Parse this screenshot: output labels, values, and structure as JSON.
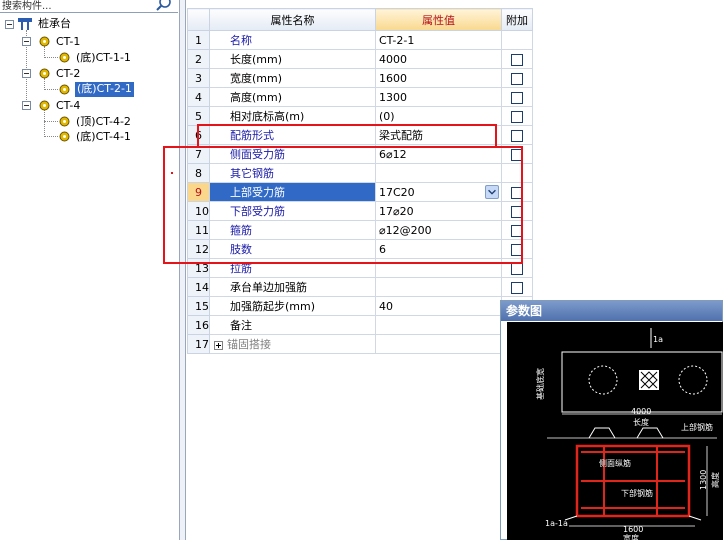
{
  "search": {
    "text": "搜索构件..."
  },
  "tree": {
    "root": "桩承台",
    "groups": [
      {
        "label": "CT-1",
        "children": [
          "(底)CT-1-1"
        ]
      },
      {
        "label": "CT-2",
        "children": [
          "(底)CT-2-1"
        ]
      },
      {
        "label": "CT-4",
        "children": [
          "(顶)CT-4-2",
          "(底)CT-4-1"
        ]
      }
    ],
    "selected": "(底)CT-2-1"
  },
  "grid": {
    "headers": {
      "name": "属性名称",
      "value": "属性值",
      "extra": "附加"
    },
    "rows": [
      {
        "no": "1",
        "name": "名称",
        "value": "CT-2-1"
      },
      {
        "no": "2",
        "name": "长度(mm)",
        "value": "4000"
      },
      {
        "no": "3",
        "name": "宽度(mm)",
        "value": "1600"
      },
      {
        "no": "4",
        "name": "高度(mm)",
        "value": "1300"
      },
      {
        "no": "5",
        "name": "相对底标高(m)",
        "value": "(0)"
      },
      {
        "no": "6",
        "name": "配筋形式",
        "value": "梁式配筋"
      },
      {
        "no": "7",
        "name": "侧面受力筋",
        "value": "6⌀12"
      },
      {
        "no": "8",
        "name": "其它钢筋",
        "value": ""
      },
      {
        "no": "9",
        "name": "上部受力筋",
        "value": "17C20"
      },
      {
        "no": "10",
        "name": "下部受力筋",
        "value": "17⌀20"
      },
      {
        "no": "11",
        "name": "箍筋",
        "value": "⌀12@200"
      },
      {
        "no": "12",
        "name": "肢数",
        "value": "6"
      },
      {
        "no": "13",
        "name": "拉筋",
        "value": ""
      },
      {
        "no": "14",
        "name": "承台单边加强筋",
        "value": ""
      },
      {
        "no": "15",
        "name": "加强筋起步(mm)",
        "value": "40"
      },
      {
        "no": "16",
        "name": "备注",
        "value": ""
      },
      {
        "no": "17",
        "name": "锚固搭接",
        "value": ""
      }
    ]
  },
  "param": {
    "title": "参数图",
    "labels": {
      "top_dim": "1a",
      "side_left": "基础底宽",
      "dim_4000": "4000",
      "len": "长度",
      "top_bar": "上部钢筋",
      "side_bar": "侧面纵筋",
      "bottom_bar": "下部钢筋",
      "dim_1500": "1300",
      "height": "高度",
      "section": "1a-1a",
      "dim_1600": "1600",
      "width": "宽度"
    }
  },
  "colors": {
    "accent": "#316ac5",
    "highlight": "#e5141b",
    "header_value": "#b5121b"
  }
}
